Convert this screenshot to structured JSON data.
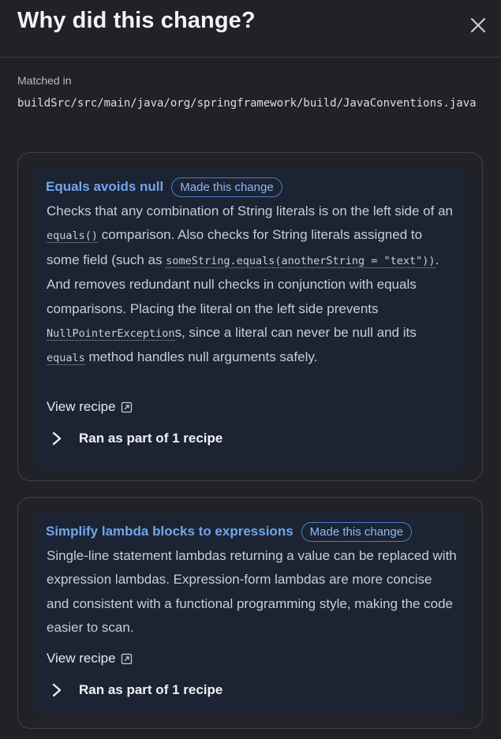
{
  "dialog": {
    "title": "Why did this change?"
  },
  "matched": {
    "label": "Matched in",
    "path": "buildSrc/src/main/java/org/springframework/build/JavaConventions.java"
  },
  "recipes": [
    {
      "title": "Equals avoids null",
      "badge": "Made this change",
      "description": {
        "t1": "Checks that any combination of String literals is on the left side of an ",
        "c1": "equals()",
        "t2": " comparison. Also checks for String literals assigned to some field (such as ",
        "c2": "someString.equals(anotherString = \"text\"))",
        "t3": ". And removes redundant null checks in conjunction with equals comparisons. Placing the literal on the left side prevents ",
        "c3": "NullPointerException",
        "t4": "s, since a literal can never be null and its ",
        "c4": "equals",
        "t5": " method handles null arguments safely."
      },
      "view_recipe": "View recipe",
      "ran_as_part": "Ran as part of 1 recipe"
    },
    {
      "title": "Simplify lambda blocks to expressions",
      "badge": "Made this change",
      "description": {
        "t1": "Single-line statement lambdas returning a value can be replaced with expression lambdas. Expression-form lambdas are more concise and consistent with a functional programming style, making the code easier to scan."
      },
      "view_recipe": "View recipe",
      "ran_as_part": "Ran as part of 1 recipe"
    }
  ],
  "icons": {
    "close": "close-icon",
    "external_link": "external-link-icon",
    "expand": "chevron-right-icon"
  },
  "colors": {
    "background": "#202227",
    "card": "#1c2333",
    "accent": "#6fa6ec"
  }
}
